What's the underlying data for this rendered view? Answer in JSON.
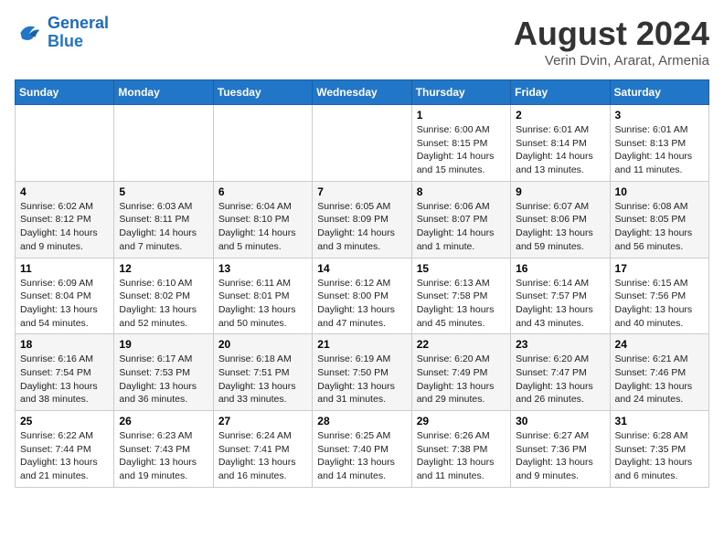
{
  "logo": {
    "line1": "General",
    "line2": "Blue"
  },
  "title": "August 2024",
  "subtitle": "Verin Dvin, Ararat, Armenia",
  "days_of_week": [
    "Sunday",
    "Monday",
    "Tuesday",
    "Wednesday",
    "Thursday",
    "Friday",
    "Saturday"
  ],
  "weeks": [
    [
      {
        "day": "",
        "info": ""
      },
      {
        "day": "",
        "info": ""
      },
      {
        "day": "",
        "info": ""
      },
      {
        "day": "",
        "info": ""
      },
      {
        "day": "1",
        "info": "Sunrise: 6:00 AM\nSunset: 8:15 PM\nDaylight: 14 hours\nand 15 minutes."
      },
      {
        "day": "2",
        "info": "Sunrise: 6:01 AM\nSunset: 8:14 PM\nDaylight: 14 hours\nand 13 minutes."
      },
      {
        "day": "3",
        "info": "Sunrise: 6:01 AM\nSunset: 8:13 PM\nDaylight: 14 hours\nand 11 minutes."
      }
    ],
    [
      {
        "day": "4",
        "info": "Sunrise: 6:02 AM\nSunset: 8:12 PM\nDaylight: 14 hours\nand 9 minutes."
      },
      {
        "day": "5",
        "info": "Sunrise: 6:03 AM\nSunset: 8:11 PM\nDaylight: 14 hours\nand 7 minutes."
      },
      {
        "day": "6",
        "info": "Sunrise: 6:04 AM\nSunset: 8:10 PM\nDaylight: 14 hours\nand 5 minutes."
      },
      {
        "day": "7",
        "info": "Sunrise: 6:05 AM\nSunset: 8:09 PM\nDaylight: 14 hours\nand 3 minutes."
      },
      {
        "day": "8",
        "info": "Sunrise: 6:06 AM\nSunset: 8:07 PM\nDaylight: 14 hours\nand 1 minute."
      },
      {
        "day": "9",
        "info": "Sunrise: 6:07 AM\nSunset: 8:06 PM\nDaylight: 13 hours\nand 59 minutes."
      },
      {
        "day": "10",
        "info": "Sunrise: 6:08 AM\nSunset: 8:05 PM\nDaylight: 13 hours\nand 56 minutes."
      }
    ],
    [
      {
        "day": "11",
        "info": "Sunrise: 6:09 AM\nSunset: 8:04 PM\nDaylight: 13 hours\nand 54 minutes."
      },
      {
        "day": "12",
        "info": "Sunrise: 6:10 AM\nSunset: 8:02 PM\nDaylight: 13 hours\nand 52 minutes."
      },
      {
        "day": "13",
        "info": "Sunrise: 6:11 AM\nSunset: 8:01 PM\nDaylight: 13 hours\nand 50 minutes."
      },
      {
        "day": "14",
        "info": "Sunrise: 6:12 AM\nSunset: 8:00 PM\nDaylight: 13 hours\nand 47 minutes."
      },
      {
        "day": "15",
        "info": "Sunrise: 6:13 AM\nSunset: 7:58 PM\nDaylight: 13 hours\nand 45 minutes."
      },
      {
        "day": "16",
        "info": "Sunrise: 6:14 AM\nSunset: 7:57 PM\nDaylight: 13 hours\nand 43 minutes."
      },
      {
        "day": "17",
        "info": "Sunrise: 6:15 AM\nSunset: 7:56 PM\nDaylight: 13 hours\nand 40 minutes."
      }
    ],
    [
      {
        "day": "18",
        "info": "Sunrise: 6:16 AM\nSunset: 7:54 PM\nDaylight: 13 hours\nand 38 minutes."
      },
      {
        "day": "19",
        "info": "Sunrise: 6:17 AM\nSunset: 7:53 PM\nDaylight: 13 hours\nand 36 minutes."
      },
      {
        "day": "20",
        "info": "Sunrise: 6:18 AM\nSunset: 7:51 PM\nDaylight: 13 hours\nand 33 minutes."
      },
      {
        "day": "21",
        "info": "Sunrise: 6:19 AM\nSunset: 7:50 PM\nDaylight: 13 hours\nand 31 minutes."
      },
      {
        "day": "22",
        "info": "Sunrise: 6:20 AM\nSunset: 7:49 PM\nDaylight: 13 hours\nand 29 minutes."
      },
      {
        "day": "23",
        "info": "Sunrise: 6:20 AM\nSunset: 7:47 PM\nDaylight: 13 hours\nand 26 minutes."
      },
      {
        "day": "24",
        "info": "Sunrise: 6:21 AM\nSunset: 7:46 PM\nDaylight: 13 hours\nand 24 minutes."
      }
    ],
    [
      {
        "day": "25",
        "info": "Sunrise: 6:22 AM\nSunset: 7:44 PM\nDaylight: 13 hours\nand 21 minutes."
      },
      {
        "day": "26",
        "info": "Sunrise: 6:23 AM\nSunset: 7:43 PM\nDaylight: 13 hours\nand 19 minutes."
      },
      {
        "day": "27",
        "info": "Sunrise: 6:24 AM\nSunset: 7:41 PM\nDaylight: 13 hours\nand 16 minutes."
      },
      {
        "day": "28",
        "info": "Sunrise: 6:25 AM\nSunset: 7:40 PM\nDaylight: 13 hours\nand 14 minutes."
      },
      {
        "day": "29",
        "info": "Sunrise: 6:26 AM\nSunset: 7:38 PM\nDaylight: 13 hours\nand 11 minutes."
      },
      {
        "day": "30",
        "info": "Sunrise: 6:27 AM\nSunset: 7:36 PM\nDaylight: 13 hours\nand 9 minutes."
      },
      {
        "day": "31",
        "info": "Sunrise: 6:28 AM\nSunset: 7:35 PM\nDaylight: 13 hours\nand 6 minutes."
      }
    ]
  ]
}
